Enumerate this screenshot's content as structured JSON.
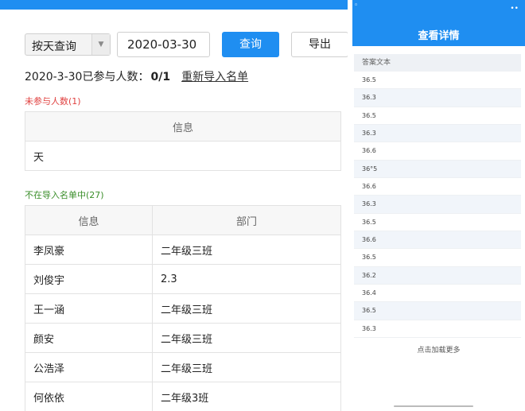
{
  "left": {
    "filter": {
      "mode_label": "按天查询",
      "date_value": "2020-03-30",
      "query_label": "查询",
      "export_label": "导出"
    },
    "stats": {
      "text": "2020-3-30已参与人数：",
      "count": "0/1",
      "reimport_label": "重新导入名单"
    },
    "not_participated": {
      "title": "未参与人数(1)",
      "header": "信息",
      "rows": [
        "天"
      ]
    },
    "not_in_list": {
      "title": "不在导入名单中(27)",
      "headers": [
        "信息",
        "部门"
      ],
      "rows": [
        [
          "李凤豪",
          "二年级三班"
        ],
        [
          "刘俊宇",
          "2.3"
        ],
        [
          "王一涵",
          "二年级三班"
        ],
        [
          "颜安",
          "二年级三班"
        ],
        [
          "公浩泽",
          "二年级三班"
        ],
        [
          "何依依",
          "二年级3班"
        ]
      ]
    }
  },
  "right": {
    "header_title": "查看详情",
    "column_header": "答案文本",
    "rows": [
      "36.5",
      "36.3",
      "36.5",
      "36.3",
      "36.6",
      "36°5",
      "36.6",
      "36.3",
      "36.5",
      "36.6",
      "36.5",
      "36.2",
      "36.4",
      "36.5",
      "36.3"
    ],
    "load_more": "点击加载更多"
  },
  "colors": {
    "accent": "#1f8ef1",
    "not_participated_title": "#e0403f",
    "not_in_list_title": "#3a8e2a"
  }
}
